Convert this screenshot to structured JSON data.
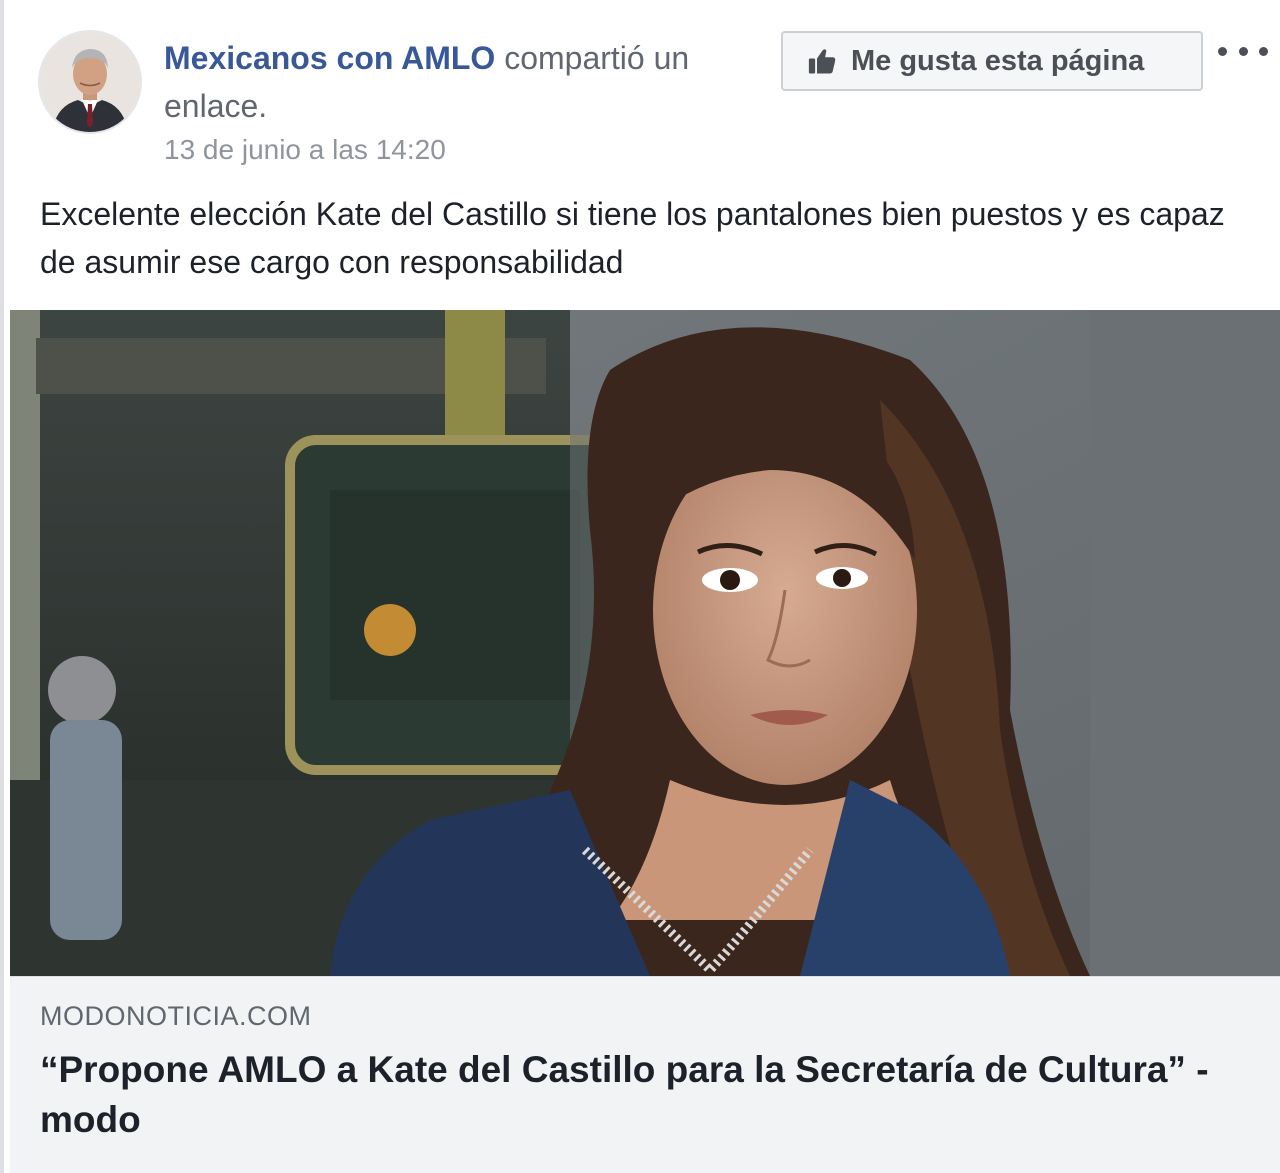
{
  "post": {
    "page_name": "Mexicanos con AMLO",
    "action_text": "compartió un enlace.",
    "timestamp": "13 de junio a las 14:20",
    "like_page_label": "Me gusta esta página",
    "more_icon": "more-options-icon",
    "message": "Excelente elección Kate del Castillo si tiene los pantalones bien puestos y es capaz de asumir ese cargo con responsabilidad"
  },
  "link": {
    "domain": "MODONOTICIA.COM",
    "title": "“Propone AMLO a Kate del Castillo para la Secretaría de Cultura” - modo"
  },
  "colors": {
    "page_name": "#385898",
    "secondary_text": "#606770",
    "link_info_background": "#f2f3f5"
  }
}
